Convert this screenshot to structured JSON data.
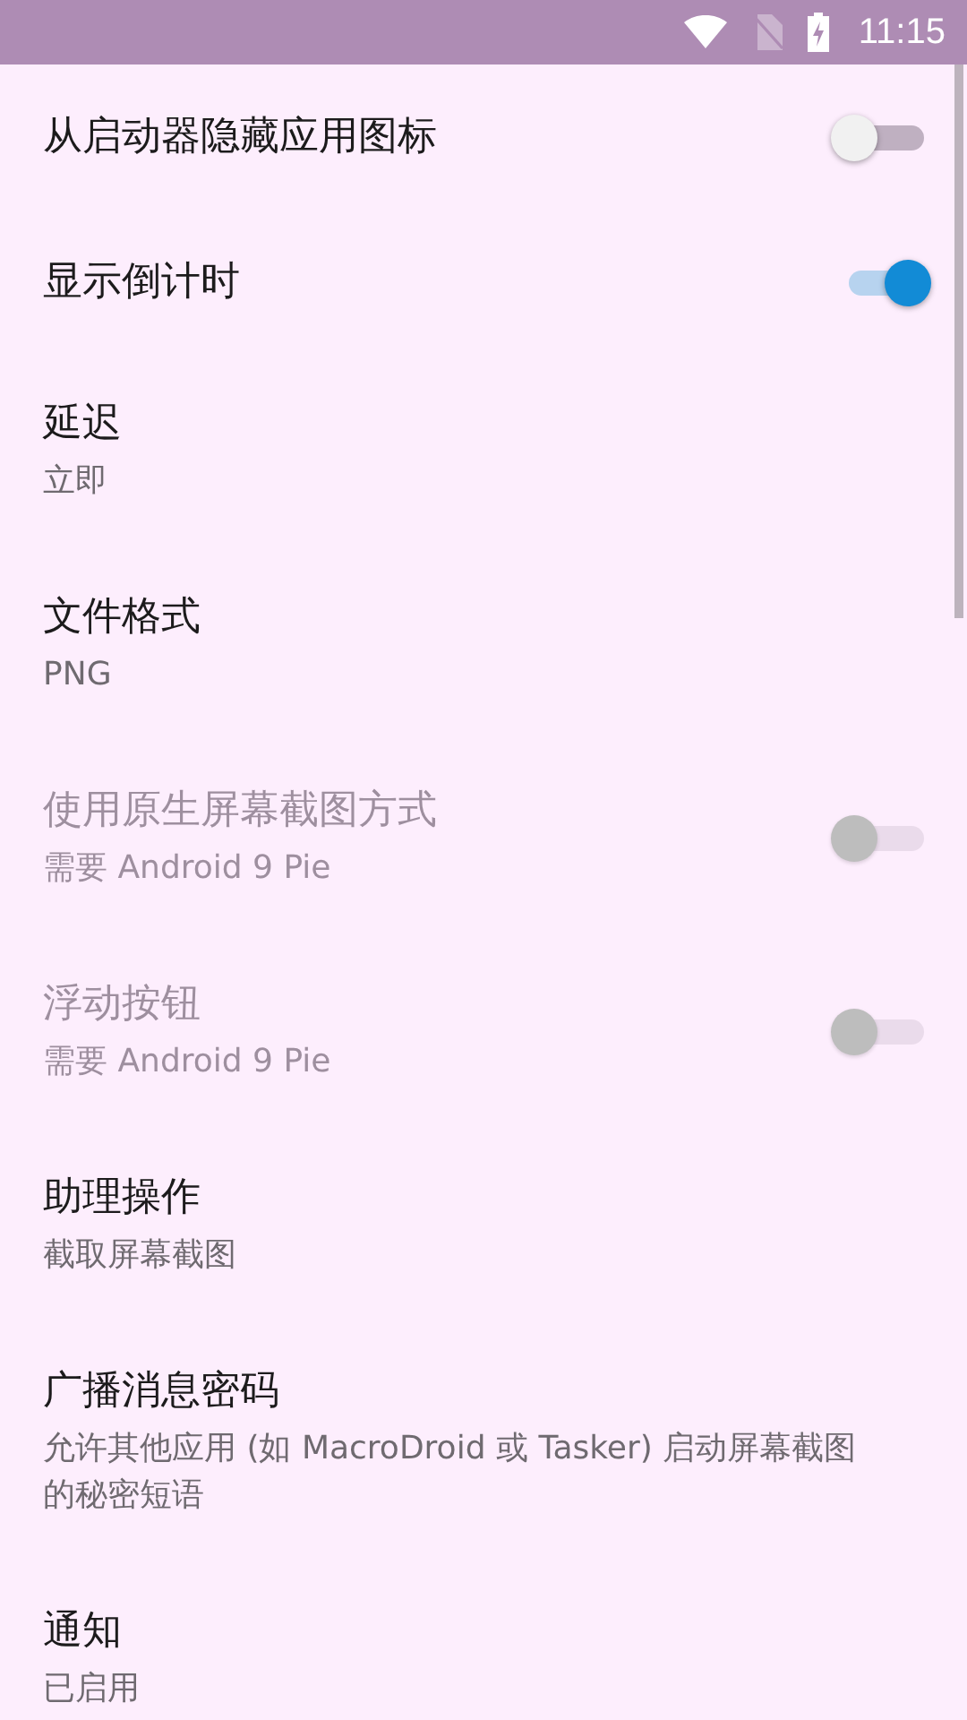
{
  "status_bar": {
    "time": "11:15"
  },
  "settings": [
    {
      "kind": "switch",
      "title": "从启动器隐藏应用图标",
      "on": false,
      "disabled": false
    },
    {
      "kind": "switch",
      "title": "显示倒计时",
      "on": true,
      "disabled": false
    },
    {
      "kind": "text",
      "title": "延迟",
      "summary": "立即"
    },
    {
      "kind": "text",
      "title": "文件格式",
      "summary": "PNG"
    },
    {
      "kind": "switch",
      "title": "使用原生屏幕截图方式",
      "summary": "需要 Android 9 Pie",
      "on": false,
      "disabled": true
    },
    {
      "kind": "switch",
      "title": "浮动按钮",
      "summary": "需要 Android 9 Pie",
      "on": false,
      "disabled": true
    },
    {
      "kind": "text",
      "title": "助理操作",
      "summary": "截取屏幕截图"
    },
    {
      "kind": "text",
      "title": "广播消息密码",
      "summary": "允许其他应用 (如 MacroDroid 或 Tasker) 启动屏幕截图的秘密短语"
    },
    {
      "kind": "text",
      "title": "通知",
      "summary": "已启用"
    }
  ]
}
